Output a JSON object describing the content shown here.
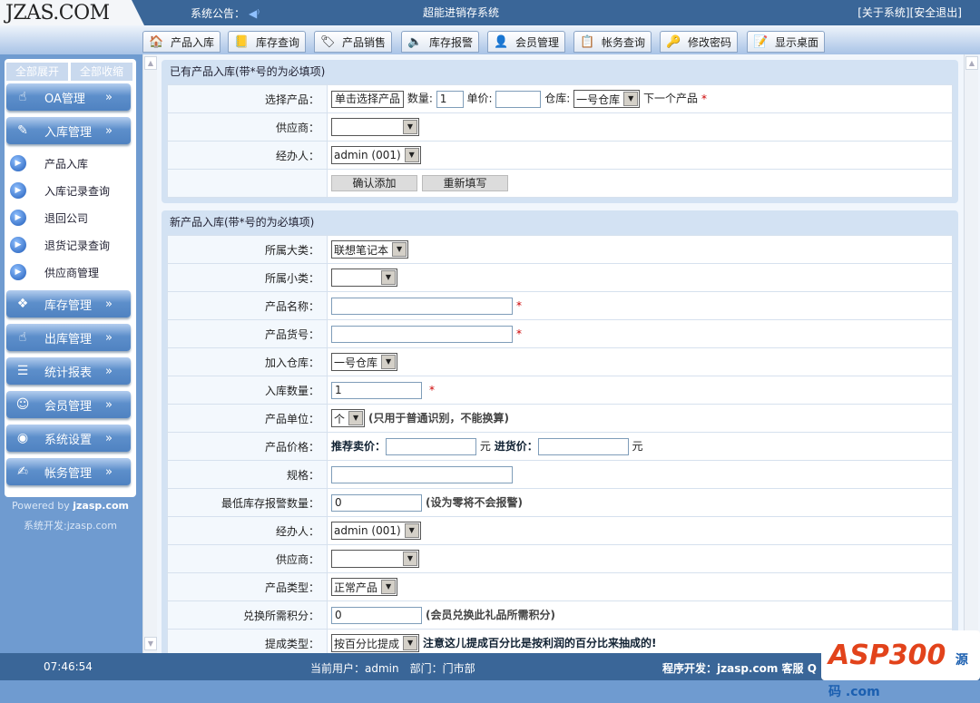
{
  "header": {
    "logo": "JZAS.COM",
    "notice_label": "系统公告：",
    "system_title": "超能进销存系统",
    "about": "[关于系统]",
    "logout": "[安全退出]"
  },
  "toolbar": [
    {
      "label": "产品入库",
      "icon": "house-icon",
      "glyph": "🏠"
    },
    {
      "label": "库存查询",
      "icon": "book-icon",
      "glyph": "📒"
    },
    {
      "label": "产品销售",
      "icon": "tag-icon",
      "glyph": "🏷"
    },
    {
      "label": "库存报警",
      "icon": "speaker-icon",
      "glyph": "🔈"
    },
    {
      "label": "会员管理",
      "icon": "member-icon",
      "glyph": "👤"
    },
    {
      "label": "帐务查询",
      "icon": "clipboard-icon",
      "glyph": "📋"
    },
    {
      "label": "修改密码",
      "icon": "key-icon",
      "glyph": "🔑"
    },
    {
      "label": "显示桌面",
      "icon": "desktop-icon",
      "glyph": "📝"
    }
  ],
  "sidebar": {
    "expand_all": "全部展开",
    "collapse_all": "全部收缩",
    "menus": [
      {
        "label": "OA管理",
        "glyph": "☝"
      },
      {
        "label": "入库管理",
        "glyph": "✎"
      },
      {
        "label": "库存管理",
        "glyph": "❖"
      },
      {
        "label": "出库管理",
        "glyph": "☝"
      },
      {
        "label": "统计报表",
        "glyph": "☰"
      },
      {
        "label": "会员管理",
        "glyph": "☺"
      },
      {
        "label": "系统设置",
        "glyph": "◉"
      },
      {
        "label": "帐务管理",
        "glyph": "✍"
      }
    ],
    "submenu": [
      "产品入库",
      "入库记录查询",
      "退回公司",
      "退货记录查询",
      "供应商管理"
    ],
    "chevron": "»",
    "powered_prefix": "Powered by ",
    "powered_site": "jzasp.com",
    "developer": "系统开发:jzasp.com"
  },
  "panel1": {
    "title": "已有产品入库(带*号的为必填项)",
    "select_product_label": "选择产品：",
    "select_product_btn": "单击选择产品",
    "qty_label": "数量:",
    "qty_value": "1",
    "price_label": "单价:",
    "price_value": "",
    "warehouse_label": "仓库:",
    "warehouse_value": "一号仓库",
    "next_product": "下一个产品",
    "supplier_label": "供应商：",
    "supplier_value": "",
    "handler_label": "经办人：",
    "handler_value": "admin (001)",
    "confirm": "确认添加",
    "reset": "重新填写"
  },
  "panel2": {
    "title": "新产品入库(带*号的为必填项)",
    "category_label": "所属大类：",
    "category_value": "联想笔记本",
    "subcategory_label": "所属小类：",
    "subcategory_value": "",
    "name_label": "产品名称：",
    "name_value": "",
    "code_label": "产品货号：",
    "code_value": "",
    "warehouse_label": "加入仓库：",
    "warehouse_value": "一号仓库",
    "qty_label": "入库数量：",
    "qty_value": "1",
    "unit_label": "产品单位：",
    "unit_value": "个",
    "unit_note": "(只用于普通识别，不能换算)",
    "price_label": "产品价格：",
    "sell_label": "推荐卖价：",
    "sell_value": "",
    "yuan": "元",
    "cost_label": "进货价：",
    "cost_value": "",
    "spec_label": "规格：",
    "spec_value": "",
    "min_stock_label": "最低库存报警数量：",
    "min_stock_value": "0",
    "min_stock_note": "(设为零将不会报警)",
    "handler_label": "经办人：",
    "handler_value": "admin (001)",
    "supplier_label": "供应商：",
    "supplier_value": "",
    "type_label": "产品类型：",
    "type_value": "正常产品",
    "points_label": "兑换所需积分：",
    "points_value": "0",
    "points_note": "(会员兑换此礼品所需积分)",
    "commission_label": "提成类型：",
    "commission_value": "按百分比提成",
    "commission_note": "注意这儿提成百分比是按利润的百分比来抽成的!"
  },
  "footer": {
    "clock": "07:46:54",
    "user": "当前用户：admin　部门：门市部",
    "developer": "程序开发：jzasp.com 客服 Q"
  },
  "watermark": {
    "text": "ASP300",
    "sub": "源码 .com"
  }
}
